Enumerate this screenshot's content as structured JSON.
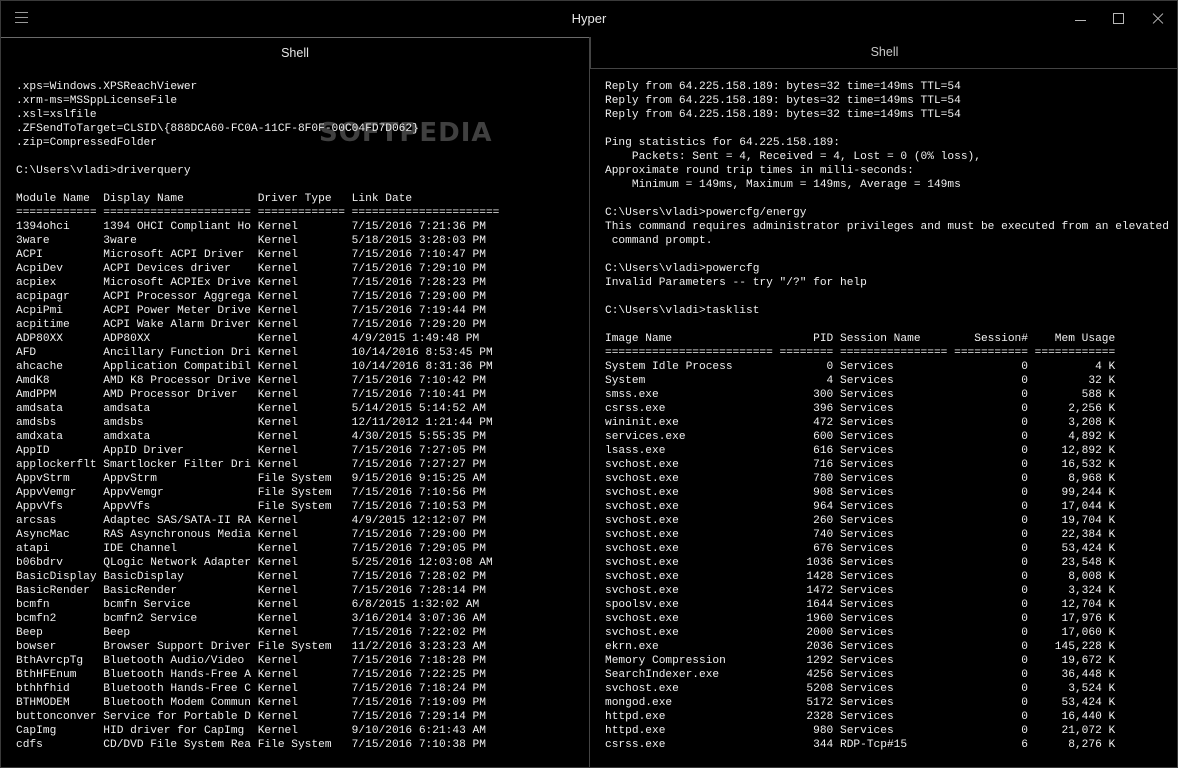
{
  "window": {
    "title": "Hyper"
  },
  "tabs": [
    {
      "label": "Shell"
    },
    {
      "label": "Shell"
    }
  ],
  "watermark": "SOFTPEDIA",
  "left_terminal": {
    "lines": [
      ".xps=Windows.XPSReachViewer",
      ".xrm-ms=MSSppLicenseFile",
      ".xsl=xslfile",
      ".ZFSendToTarget=CLSID\\{888DCA60-FC0A-11CF-8F0F-00C04FD7D062}",
      ".zip=CompressedFolder",
      "",
      "C:\\Users\\vladi>driverquery",
      "",
      "Module Name  Display Name           Driver Type   Link Date",
      "============ ====================== ============= ======================",
      "1394ohci     1394 OHCI Compliant Ho Kernel        7/15/2016 7:21:36 PM",
      "3ware        3ware                  Kernel        5/18/2015 3:28:03 PM",
      "ACPI         Microsoft ACPI Driver  Kernel        7/15/2016 7:10:47 PM",
      "AcpiDev      ACPI Devices driver    Kernel        7/15/2016 7:29:10 PM",
      "acpiex       Microsoft ACPIEx Drive Kernel        7/15/2016 7:28:23 PM",
      "acpipagr     ACPI Processor Aggrega Kernel        7/15/2016 7:29:00 PM",
      "AcpiPmi      ACPI Power Meter Drive Kernel        7/15/2016 7:19:44 PM",
      "acpitime     ACPI Wake Alarm Driver Kernel        7/15/2016 7:29:20 PM",
      "ADP80XX      ADP80XX                Kernel        4/9/2015 1:49:48 PM",
      "AFD          Ancillary Function Dri Kernel        10/14/2016 8:53:45 PM",
      "ahcache      Application Compatibil Kernel        10/14/2016 8:31:36 PM",
      "AmdK8        AMD K8 Processor Drive Kernel        7/15/2016 7:10:42 PM",
      "AmdPPM       AMD Processor Driver   Kernel        7/15/2016 7:10:41 PM",
      "amdsata      amdsata                Kernel        5/14/2015 5:14:52 AM",
      "amdsbs       amdsbs                 Kernel        12/11/2012 1:21:44 PM",
      "amdxata      amdxata                Kernel        4/30/2015 5:55:35 PM",
      "AppID        AppID Driver           Kernel        7/15/2016 7:27:05 PM",
      "applockerflt Smartlocker Filter Dri Kernel        7/15/2016 7:27:27 PM",
      "AppvStrm     AppvStrm               File System   9/15/2016 9:15:25 AM",
      "AppvVemgr    AppvVemgr              File System   7/15/2016 7:10:56 PM",
      "AppvVfs      AppvVfs                File System   7/15/2016 7:10:53 PM",
      "arcsas       Adaptec SAS/SATA-II RA Kernel        4/9/2015 12:12:07 PM",
      "AsyncMac     RAS Asynchronous Media Kernel        7/15/2016 7:29:00 PM",
      "atapi        IDE Channel            Kernel        7/15/2016 7:29:05 PM",
      "b06bdrv      QLogic Network Adapter Kernel        5/25/2016 12:03:08 AM",
      "BasicDisplay BasicDisplay           Kernel        7/15/2016 7:28:02 PM",
      "BasicRender  BasicRender            Kernel        7/15/2016 7:28:14 PM",
      "bcmfn        bcmfn Service          Kernel        6/8/2015 1:32:02 AM",
      "bcmfn2       bcmfn2 Service         Kernel        3/16/2014 3:07:36 AM",
      "Beep         Beep                   Kernel        7/15/2016 7:22:02 PM",
      "bowser       Browser Support Driver File System   11/2/2016 3:23:23 AM",
      "BthAvrcpTg   Bluetooth Audio/Video  Kernel        7/15/2016 7:18:28 PM",
      "BthHFEnum    Bluetooth Hands-Free A Kernel        7/15/2016 7:22:25 PM",
      "bthhfhid     Bluetooth Hands-Free C Kernel        7/15/2016 7:18:24 PM",
      "BTHMODEM     Bluetooth Modem Commun Kernel        7/15/2016 7:19:09 PM",
      "buttonconver Service for Portable D Kernel        7/15/2016 7:29:14 PM",
      "CapImg       HID driver for CapImg  Kernel        9/10/2016 6:21:43 AM",
      "cdfs         CD/DVD File System Rea File System   7/15/2016 7:10:38 PM"
    ]
  },
  "right_terminal": {
    "lines": [
      "Reply from 64.225.158.189: bytes=32 time=149ms TTL=54",
      "Reply from 64.225.158.189: bytes=32 time=149ms TTL=54",
      "Reply from 64.225.158.189: bytes=32 time=149ms TTL=54",
      "",
      "Ping statistics for 64.225.158.189:",
      "    Packets: Sent = 4, Received = 4, Lost = 0 (0% loss),",
      "Approximate round trip times in milli-seconds:",
      "    Minimum = 149ms, Maximum = 149ms, Average = 149ms",
      "",
      "C:\\Users\\vladi>powercfg/energy",
      "This command requires administrator privileges and must be executed from an elevated",
      " command prompt.",
      "",
      "C:\\Users\\vladi>powercfg",
      "Invalid Parameters -- try \"/?\" for help",
      "",
      "C:\\Users\\vladi>tasklist",
      "",
      "Image Name                     PID Session Name        Session#    Mem Usage",
      "========================= ======== ================ =========== ============",
      "System Idle Process              0 Services                   0          4 K",
      "System                           4 Services                   0         32 K",
      "smss.exe                       300 Services                   0        588 K",
      "csrss.exe                      396 Services                   0      2,256 K",
      "wininit.exe                    472 Services                   0      3,208 K",
      "services.exe                   600 Services                   0      4,892 K",
      "lsass.exe                      616 Services                   0     12,892 K",
      "svchost.exe                    716 Services                   0     16,532 K",
      "svchost.exe                    780 Services                   0      8,968 K",
      "svchost.exe                    908 Services                   0     99,244 K",
      "svchost.exe                    964 Services                   0     17,044 K",
      "svchost.exe                    260 Services                   0     19,704 K",
      "svchost.exe                    740 Services                   0     22,384 K",
      "svchost.exe                    676 Services                   0     53,424 K",
      "svchost.exe                   1036 Services                   0     23,548 K",
      "svchost.exe                   1428 Services                   0      8,008 K",
      "svchost.exe                   1472 Services                   0      3,324 K",
      "spoolsv.exe                   1644 Services                   0     12,704 K",
      "svchost.exe                   1960 Services                   0     17,976 K",
      "svchost.exe                   2000 Services                   0     17,060 K",
      "ekrn.exe                      2036 Services                   0    145,228 K",
      "Memory Compression            1292 Services                   0     19,672 K",
      "SearchIndexer.exe             4256 Services                   0     36,448 K",
      "svchost.exe                   5208 Services                   0      3,524 K",
      "mongod.exe                    5172 Services                   0     53,424 K",
      "httpd.exe                     2328 Services                   0     16,440 K",
      "httpd.exe                      980 Services                   0     21,072 K",
      "csrss.exe                      344 RDP-Tcp#15                 6      8,276 K"
    ]
  }
}
